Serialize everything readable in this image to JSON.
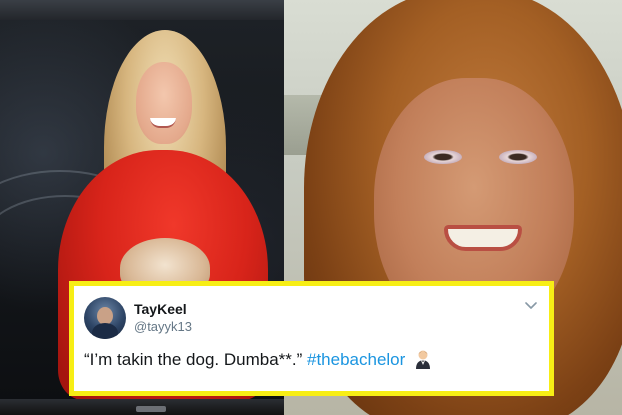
{
  "tweet": {
    "display_name": "TayKeel",
    "handle": "@tayyk13",
    "text": "“I’m takin the dog. Dumba**.”",
    "hashtag": "#thebachelor",
    "emoji": "man-in-tuxedo",
    "menu_icon": "chevron-down-icon"
  },
  "colors": {
    "card_border": "#f7ee15",
    "hashtag": "#1b95e0",
    "handle": "#657786",
    "text": "#14171a"
  }
}
